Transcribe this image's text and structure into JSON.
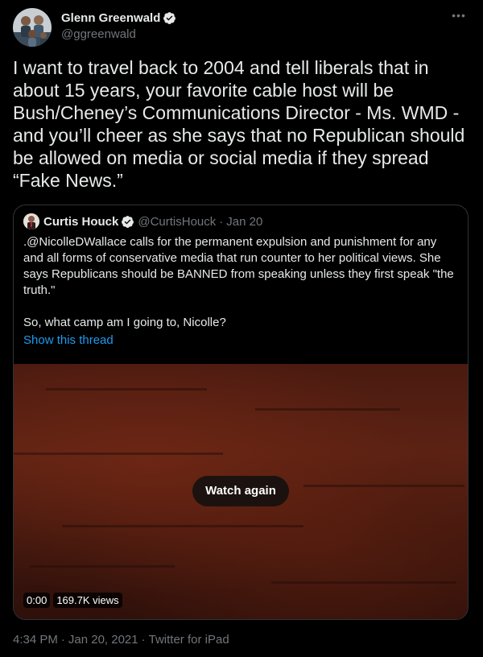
{
  "author": {
    "display_name": "Glenn Greenwald",
    "handle": "@ggreenwald",
    "verified_icon": "verified-badge-icon",
    "more_icon": "more-options-icon"
  },
  "tweet": {
    "text": "I want to travel back to 2004 and tell liberals that in about 15 years, your favorite cable host will be Bush/Cheney’s Communications Director - Ms. WMD - and you’ll cheer as she says that no Republican should be allowed on media or social media if they spread “Fake News.”"
  },
  "quoted": {
    "display_name": "Curtis Houck",
    "handle": "@CurtisHouck",
    "separator": "·",
    "date": "Jan 20",
    "text": ".@NicolleDWallace calls for the permanent expulsion and punishment for any and all forms of conservative media that run counter to her political views. She says Republicans should be BANNED from speaking unless they first speak \"the truth.\"\n\nSo, what camp am I going to, Nicolle?",
    "thread_link": "Show this thread",
    "video": {
      "button_label": "Watch again",
      "time": "0:00",
      "views": "169.7K views"
    }
  },
  "footer": {
    "time": "4:34 PM",
    "separator": "·",
    "date": "Jan 20, 2021",
    "source": "Twitter for iPad"
  },
  "colors": {
    "background": "#000000",
    "text": "#e7e9ea",
    "secondary": "#71767b",
    "link": "#1d9bf0",
    "verified": "#e7e9ea",
    "border": "#2f3336"
  }
}
